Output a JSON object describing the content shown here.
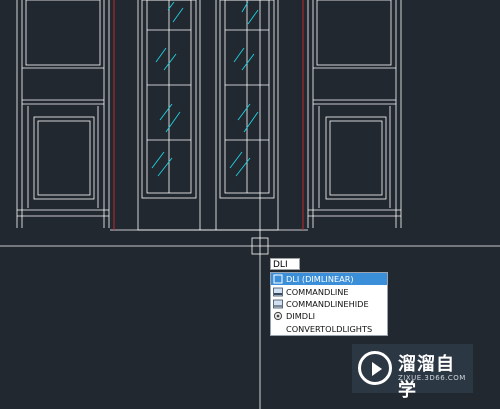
{
  "app": {
    "name": "AutoCAD model space"
  },
  "colors": {
    "background": "#212830",
    "drawing_line": "#ffffff",
    "glass_hatch": "#20d0e0",
    "red_line": "#c0262c",
    "highlight": "#3b8fd8"
  },
  "command": {
    "typed_text": "DLI"
  },
  "autocomplete": {
    "items": [
      {
        "label": "DLI (DIMLINEAR)",
        "icon": "dimlinear-icon",
        "selected": true
      },
      {
        "label": "COMMANDLINE",
        "icon": "commandline-icon",
        "selected": false
      },
      {
        "label": "COMMANDLINEHIDE",
        "icon": "commandlinehide-icon",
        "selected": false
      },
      {
        "label": "DIMDLI",
        "icon": "dimdli-gear-icon",
        "selected": false
      },
      {
        "label": "CONVERTOLDLIGHTS",
        "icon": "",
        "selected": false
      }
    ]
  },
  "watermark": {
    "name": "溜溜自学",
    "url": "ZIXUE.3D66.COM"
  }
}
